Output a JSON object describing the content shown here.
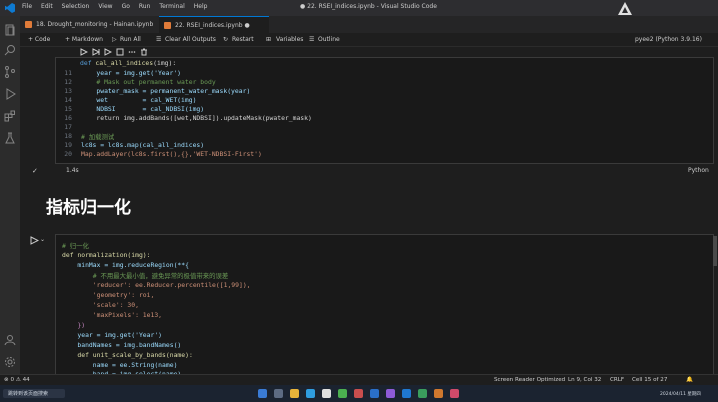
{
  "titlebar": {
    "menu": [
      "File",
      "Edit",
      "Selection",
      "View",
      "Go",
      "Run",
      "Terminal",
      "Help"
    ],
    "title": "● 22. RSEI_indices.ipynb - Visual Studio Code"
  },
  "tabs": [
    {
      "label": "18. Drought_monitoring - Hainan.ipynb"
    },
    {
      "label": "22. RSEI_indices.ipynb  ●"
    }
  ],
  "toolbar": {
    "code": "+ Code",
    "markdown": "+ Markdown",
    "run_all": "Run All",
    "clear": "Clear All Outputs",
    "restart": "Restart",
    "variables": "Variables",
    "outline": "Outline",
    "kernel": "pyee2 (Python 3.9.16)"
  },
  "cell1": {
    "lines": [
      {
        "n": "11",
        "t": "    year = img.get('Year')"
      },
      {
        "n": "12",
        "t": "    # Mask out permanent water body"
      },
      {
        "n": "13",
        "t": "    pwater_mask = permanent_water_mask(year)"
      },
      {
        "n": "14",
        "t": "    wet         = cal_WET(img)"
      },
      {
        "n": "15",
        "t": "    NDBSI       = cal_NDBSI(img)"
      },
      {
        "n": "16",
        "t": "    return img.addBands([wet,NDBSI]).updateMask(pwater_mask)"
      },
      {
        "n": "17",
        "t": ""
      },
      {
        "n": "18",
        "t": "# 加载测试"
      },
      {
        "n": "19",
        "t": "lc8s = lc8s.map(cal_all_indices)"
      },
      {
        "n": "20",
        "t": "Map.addLayer(lc8s.first(),{},'WET-NDBSI-First')"
      }
    ],
    "exec_time": "1.4s",
    "language": "Python"
  },
  "markdown": {
    "heading": "指标归一化"
  },
  "cell2": {
    "lines": [
      "# 归一化",
      "def normalization(img):",
      "    minMax = img.reduceRegion(**{",
      "        # 不用最大最小值，避免异常的极值带来的误差",
      "        'reducer': ee.Reducer.percentile([1,99]),",
      "        'geometry': roi,",
      "        'scale': 30,",
      "        'maxPixels': 1e13,",
      "    })",
      "    year = img.get('Year')",
      "    bandNames = img.bandNames()",
      "    def unit_scale_by_bands(name):",
      "        name = ee.String(name)",
      "        band = img.select(name)"
    ]
  },
  "status": {
    "left": "⊗ 0 ⚠ 44",
    "screen_reader": "Screen Reader Optimized",
    "position": "Ln 9, Col 32",
    "eol": "CRLF",
    "cell": "Cell 15 of 27"
  },
  "taskbar": {
    "left_text": "跳转到该页面搜索",
    "clock": "2024/04/11 星期四"
  },
  "watermark": "大风阳光 Data Science Research"
}
